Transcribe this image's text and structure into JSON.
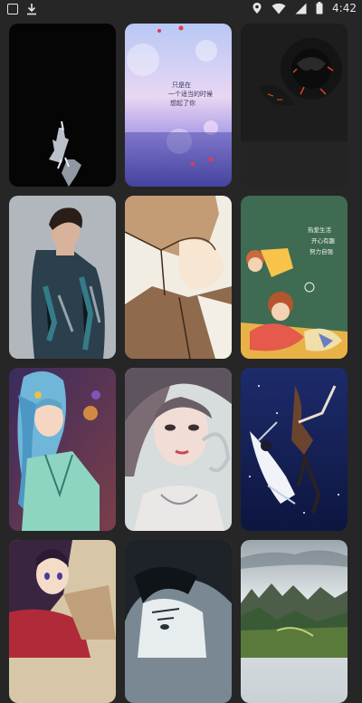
{
  "status_bar": {
    "time": "4:42",
    "left_icons": [
      "app-icon",
      "download-icon"
    ],
    "right_icons": [
      "location-icon",
      "wifi-icon",
      "signal-icon",
      "battery-icon"
    ]
  },
  "wallpapers": [
    {
      "id": 1,
      "subject": "dark-hands",
      "row": 1,
      "col": 1
    },
    {
      "id": 2,
      "subject": "pastel-sea",
      "row": 1,
      "col": 2,
      "caption": "只是在\n一个适当的时候\n想起了你"
    },
    {
      "id": 3,
      "subject": "black-rose",
      "row": 1,
      "col": 3
    },
    {
      "id": 4,
      "subject": "man-glitter-jacket",
      "row": 2,
      "col": 1
    },
    {
      "id": 5,
      "subject": "anime-boy-brown-hair",
      "row": 2,
      "col": 2
    },
    {
      "id": 6,
      "subject": "cartoon-couple-green",
      "row": 2,
      "col": 3,
      "caption": "热爱生活\n开心有趣\n努力自强"
    },
    {
      "id": 7,
      "subject": "blue-hair-princess",
      "row": 3,
      "col": 1
    },
    {
      "id": 8,
      "subject": "3d-girl-portrait",
      "row": 3,
      "col": 2
    },
    {
      "id": 9,
      "subject": "anime-falling-sky",
      "row": 3,
      "col": 3
    },
    {
      "id": 10,
      "subject": "anime-girl-dark-hair",
      "row": 4,
      "col": 1
    },
    {
      "id": 11,
      "subject": "anime-boy-dark-hair",
      "row": 4,
      "col": 2
    },
    {
      "id": 12,
      "subject": "mountain-landscape",
      "row": 4,
      "col": 3
    }
  ]
}
